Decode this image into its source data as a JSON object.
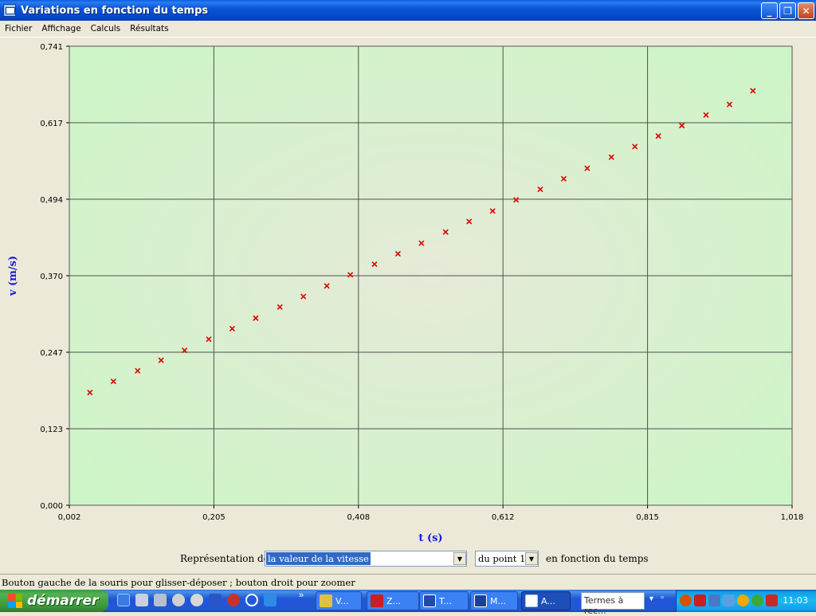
{
  "window": {
    "title": "Variations en fonction du temps"
  },
  "menubar": {
    "items": [
      "Fichier",
      "Affichage",
      "Calculs",
      "Résultats"
    ]
  },
  "chart_data": {
    "type": "scatter",
    "xlabel": "t (s)",
    "ylabel": "v (m/s)",
    "xlim": [
      0.002,
      1.018
    ],
    "ylim": [
      0.0,
      0.741
    ],
    "x_ticks": [
      "0,002",
      "0,205",
      "0,408",
      "0,612",
      "0,815",
      "1,018"
    ],
    "y_ticks": [
      "0,000",
      "0,123",
      "0,247",
      "0,370",
      "0,494",
      "0,617",
      "0,741"
    ],
    "grid": true,
    "background_color": "#d8f5d0",
    "marker_color": "#e00000",
    "series": [
      {
        "x": [
          0.031,
          0.064,
          0.098,
          0.131,
          0.164,
          0.198,
          0.231,
          0.264,
          0.298,
          0.331,
          0.364,
          0.397,
          0.431,
          0.464,
          0.497,
          0.531,
          0.564,
          0.597,
          0.63,
          0.664,
          0.697,
          0.73,
          0.764,
          0.797,
          0.83,
          0.863,
          0.897,
          0.93,
          0.963
        ],
        "y": [
          0.182,
          0.2,
          0.217,
          0.234,
          0.25,
          0.268,
          0.285,
          0.302,
          0.32,
          0.337,
          0.354,
          0.372,
          0.389,
          0.406,
          0.423,
          0.441,
          0.458,
          0.475,
          0.493,
          0.51,
          0.527,
          0.544,
          0.562,
          0.579,
          0.596,
          0.613,
          0.63,
          0.647,
          0.669
        ]
      }
    ]
  },
  "controls": {
    "representation_label": "Représentation de",
    "representation_value": "la valeur de la vitesse",
    "point_value": "du point 1",
    "suffix_label": "en fonction du temps"
  },
  "statusbar": {
    "text": "Bouton gauche de la souris pour glisser-déposer ; bouton droit pour zoomer"
  },
  "taskbar": {
    "start_label": "démarrer",
    "tasks": [
      "V...",
      "Z...",
      "T...",
      "M...",
      "A..."
    ],
    "search_placeholder": "Termes à rec...",
    "clock": "11:03"
  }
}
